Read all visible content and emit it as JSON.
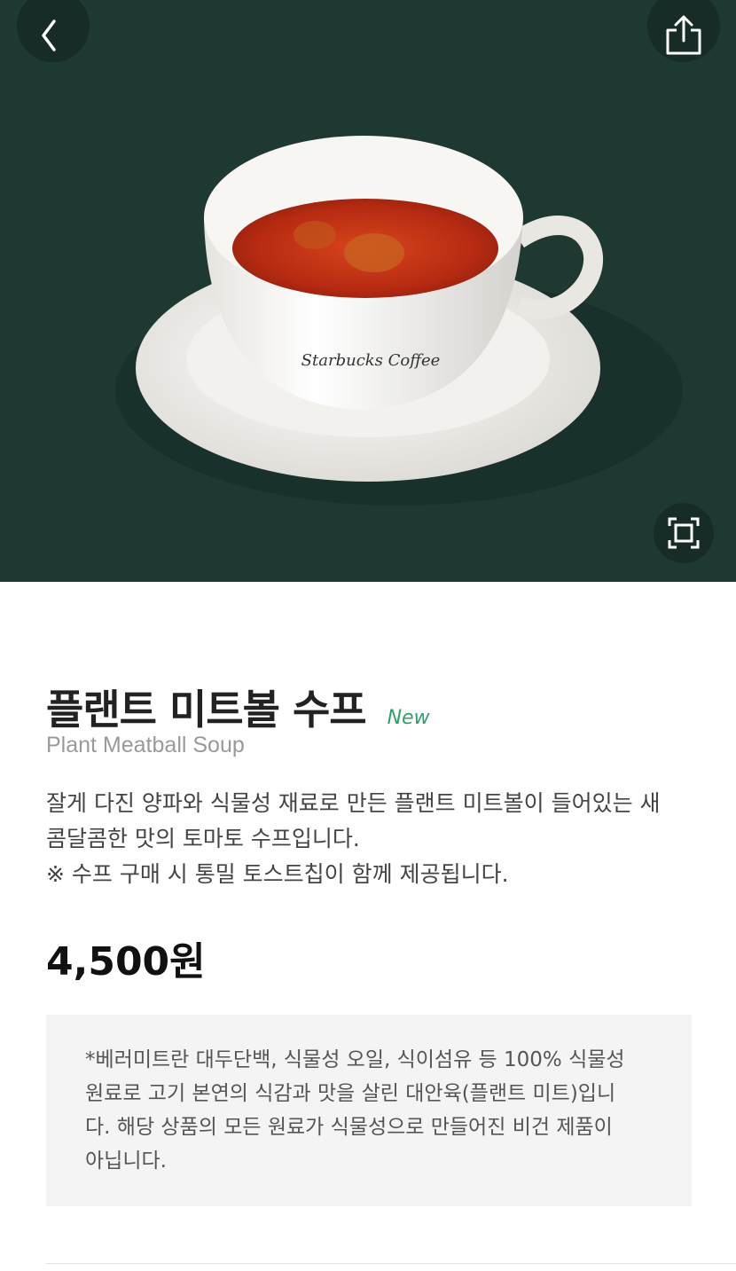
{
  "product": {
    "name_ko": "플랜트 미트볼 수프",
    "badge": "New",
    "name_en": "Plant Meatball Soup",
    "description": [
      "잘게 다진 양파와 식물성 재료로 만든 플랜트 미트볼이 들어있는 새",
      "콤달콤한 맛의 토마토 수프입니다.",
      "※ 수프 구매 시 통밀 토스트칩이 함께 제공됩니다."
    ],
    "price": "4,500원",
    "note": [
      "*베러미트란 대두단백, 식물성 오일, 식이섬유 등 100% 식물성",
      "원료로 고기 본연의 식감과 맛을 살린 대안육(플랜트 미트)입니",
      "다. 해당 상품의 모든 원료가 식물성으로 만들어진 비건 제품이",
      "아닙니다."
    ],
    "cup_print": "Starbucks Coffee"
  },
  "icons": {
    "back": "chevron-left-icon",
    "share": "share-icon",
    "zoom": "expand-icon"
  },
  "colors": {
    "hero_bg": "#1e3932",
    "badge": "#2f9f6b"
  }
}
